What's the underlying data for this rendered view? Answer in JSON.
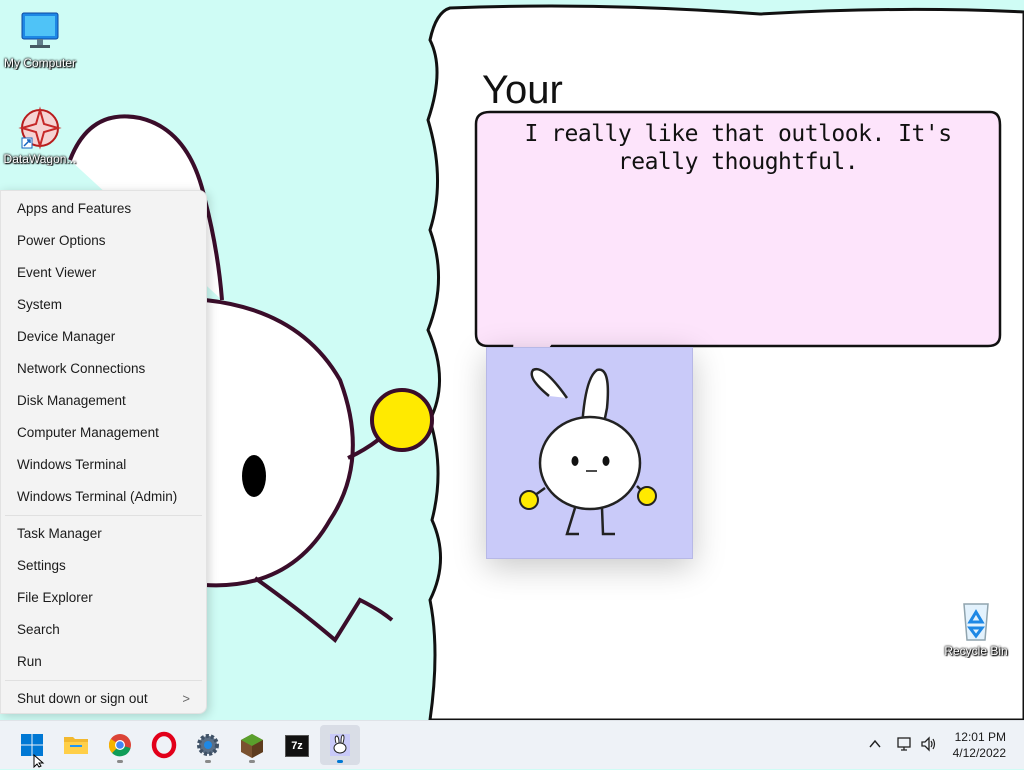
{
  "desktop": {
    "icons": [
      {
        "label": "My Computer"
      },
      {
        "label": "DataWagon..."
      },
      {
        "label": "Recycle Bin"
      }
    ]
  },
  "speech_bubble": {
    "text": "I really like that outlook. It's really thoughtful."
  },
  "heading": "Your",
  "winx_menu": {
    "group1": [
      "Apps and Features",
      "Power Options",
      "Event Viewer",
      "System",
      "Device Manager",
      "Network Connections",
      "Disk Management",
      "Computer Management",
      "Windows Terminal",
      "Windows Terminal (Admin)"
    ],
    "group2": [
      "Task Manager",
      "Settings",
      "File Explorer",
      "Search",
      "Run"
    ],
    "shutdown": {
      "label": "Shut down or sign out",
      "chevron": ">"
    }
  },
  "taskbar": {
    "apps": [
      "start-icon",
      "file-explorer-icon",
      "chrome-icon",
      "opera-icon",
      "settings-icon",
      "minecraft-icon",
      "7zip-icon",
      "bunny-app-icon"
    ],
    "sevenzip_label": "7z",
    "time": "12:01 PM",
    "date": "4/12/2022"
  },
  "colors": {
    "wallpaper": "#cffcf5",
    "bubble": "#fde4fb",
    "app_bg": "#c9caf9",
    "taskbar": "#eef2f7",
    "accent": "#0078d4"
  }
}
